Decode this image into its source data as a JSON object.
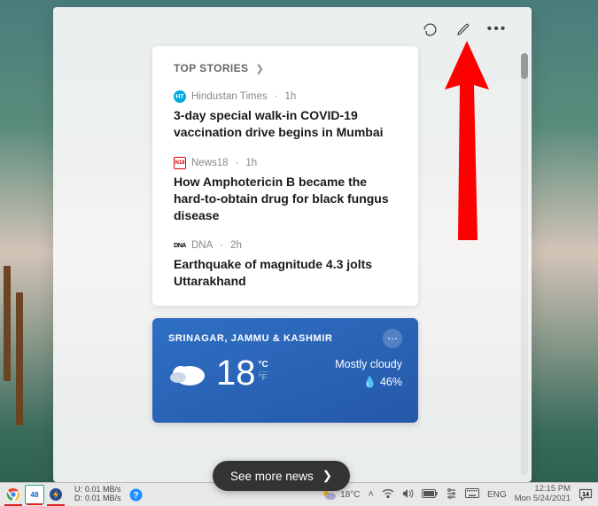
{
  "toolbar": {
    "refresh": "refresh",
    "edit": "edit",
    "more": "more"
  },
  "news": {
    "header": "TOP STORIES",
    "stories": [
      {
        "icon": "ht",
        "source": "Hindustan Times",
        "age": "1h",
        "headline": "3-day special walk-in COVID-19 vaccination drive begins in Mumbai"
      },
      {
        "icon": "n18",
        "source": "News18",
        "age": "1h",
        "headline": "How Amphotericin B became the hard-to-obtain drug for black fungus disease"
      },
      {
        "icon": "dna",
        "source": "DNA",
        "age": "2h",
        "headline": "Earthquake of magnitude 4.3 jolts Uttarakhand"
      }
    ]
  },
  "weather": {
    "location": "SRINAGAR, JAMMU & KASHMIR",
    "temp": "18",
    "unit_c": "°C",
    "unit_f": "°F",
    "condition": "Mostly cloudy",
    "humidity": "46%"
  },
  "see_more": "See more news",
  "taskbar": {
    "badge": "48",
    "net": {
      "u_label": "U:",
      "u_val": "0.01 MB/s",
      "d_label": "D:",
      "d_val": "0.01 MB/s"
    },
    "weather_temp": "18°C",
    "lang": "ENG",
    "time": "12:15 PM",
    "date": "Mon 5/24/2021",
    "notif_count": "14"
  }
}
